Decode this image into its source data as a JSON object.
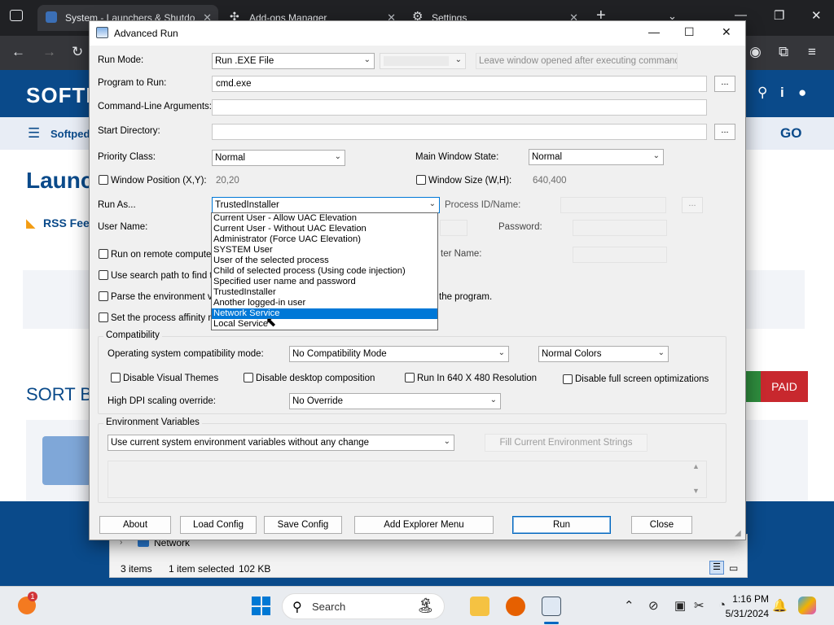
{
  "browser": {
    "tabs": [
      {
        "label": "System - Launchers & Shutdo"
      },
      {
        "label": "Add-ons Manager"
      },
      {
        "label": "Settings"
      }
    ],
    "new_tab": "+",
    "site": {
      "logo": "SOFTPEDIA",
      "nav_label": "Softpedia",
      "go": "GO",
      "heading": "Launch",
      "rss": "RSS Feed",
      "sort_by": "SORT BY",
      "paid": "PAID"
    }
  },
  "explorer": {
    "network": "Network",
    "items": "3 items",
    "selected": "1 item selected",
    "size": "102 KB"
  },
  "dialog": {
    "title": "Advanced Run",
    "run_mode_label": "Run Mode:",
    "run_mode_value": "Run .EXE File",
    "leave_window": "Leave window opened after executing command",
    "program_label": "Program to Run:",
    "program_value": "cmd.exe",
    "args_label": "Command-Line Arguments:",
    "args_value": "",
    "startdir_label": "Start Directory:",
    "startdir_value": "",
    "ellipsis": "...",
    "priority_label": "Priority Class:",
    "priority_value": "Normal",
    "mainwin_label": "Main Window State:",
    "mainwin_value": "Normal",
    "winpos_label": "Window Position (X,Y):",
    "winpos_value": "20,20",
    "winsize_label": "Window Size (W,H):",
    "winsize_value": "640,400",
    "runas_label": "Run As...",
    "runas_value": "TrustedInstaller",
    "procid_label": "Process ID/Name:",
    "username_label": "User Name:",
    "password_label": "Password:",
    "remote_label": "Run on remote computer",
    "computer_name_label": "ter Name:",
    "search_path_label": "Use search path to find th",
    "parse_env_label": "Parse the environment va",
    "parse_env_tail": "the program.",
    "affinity_label": "Set the process affinity m",
    "runas_options": [
      "Current User - Allow UAC Elevation",
      "Current User - Without UAC Elevation",
      "Administrator (Force UAC Elevation)",
      "SYSTEM User",
      "User of the selected process",
      "Child of selected process (Using code injection)",
      "Specified user name and password",
      "TrustedInstaller",
      "Another logged-in user",
      "Network Service",
      "Local Service"
    ],
    "runas_highlighted": "Network Service",
    "compat": {
      "group": "Compatibility",
      "os_mode_label": "Operating system compatibility mode:",
      "os_mode_value": "No Compatibility Mode",
      "colors_value": "Normal Colors",
      "disable_themes": "Disable Visual Themes",
      "disable_composition": "Disable desktop composition",
      "run_640": "Run In 640 X 480 Resolution",
      "disable_fullscreen": "Disable full screen optimizations",
      "dpi_label": "High DPI scaling override:",
      "dpi_value": "No Override"
    },
    "env": {
      "group": "Environment Variables",
      "mode_value": "Use current system environment variables without any change",
      "fill_button": "Fill Current Environment Strings"
    },
    "buttons": {
      "about": "About",
      "load": "Load Config",
      "save": "Save Config",
      "explorer_menu": "Add Explorer Menu",
      "run": "Run",
      "close": "Close"
    }
  },
  "taskbar": {
    "search_placeholder": "Search",
    "time": "1:16 PM",
    "date": "5/31/2024",
    "notification_count": "1"
  },
  "colors": {
    "accent": "#0078d7",
    "site_blue": "#0a4a8a",
    "paid_red": "#c8282e"
  }
}
